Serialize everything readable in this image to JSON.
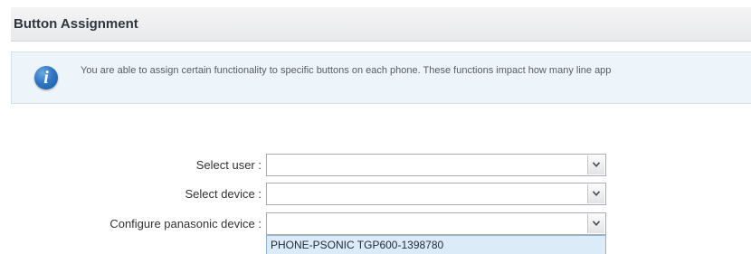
{
  "header": {
    "title": "Button Assignment"
  },
  "info": {
    "icon": "info-icon",
    "text": "You are able to assign certain functionality to specific buttons on each phone. These functions impact how many line app"
  },
  "form": {
    "select_user": {
      "label": "Select user :",
      "value": ""
    },
    "select_device": {
      "label": "Select device :",
      "value": ""
    },
    "configure_device": {
      "label": "Configure panasonic device :",
      "value": ""
    },
    "dropdown_options": [
      "PHONE-PSONIC TGP600-1398780"
    ]
  },
  "colors": {
    "header_bg": "#ecedef",
    "info_bg": "#eef5fa",
    "info_icon": "#2f77c4",
    "option_highlight": "#dcebf8"
  }
}
